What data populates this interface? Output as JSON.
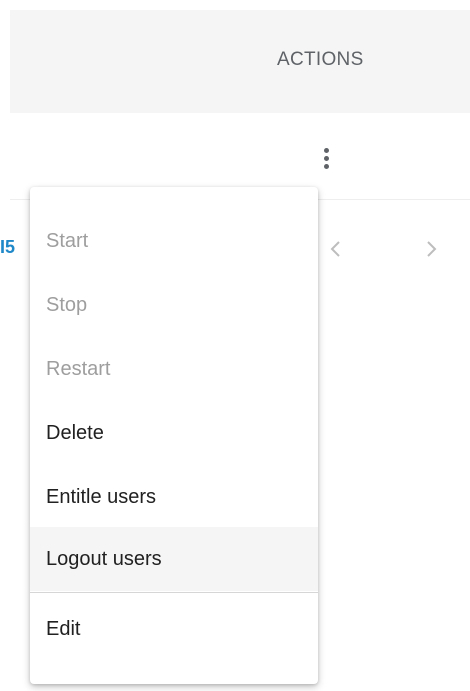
{
  "table": {
    "actions_header": "ACTIONS",
    "row_link_fragment": "I5"
  },
  "icons": {
    "row_menu": "more-vert-icon",
    "prev_page": "chevron-left-icon",
    "next_page": "chevron-right-icon"
  },
  "menu": {
    "items": [
      {
        "label": "Start",
        "enabled": false
      },
      {
        "label": "Stop",
        "enabled": false
      },
      {
        "label": "Restart",
        "enabled": false
      },
      {
        "label": "Delete",
        "enabled": true
      },
      {
        "label": "Entitle users",
        "enabled": true
      },
      {
        "label": "Logout users",
        "enabled": true,
        "hovered": true
      },
      {
        "label": "Edit",
        "enabled": true
      }
    ]
  },
  "colors": {
    "header_bg": "#f5f5f5",
    "header_text": "#5f6368",
    "link": "#1e88c8",
    "disabled_text": "#9e9e9e",
    "enabled_text": "#212121",
    "hover_bg": "#f5f5f5"
  }
}
